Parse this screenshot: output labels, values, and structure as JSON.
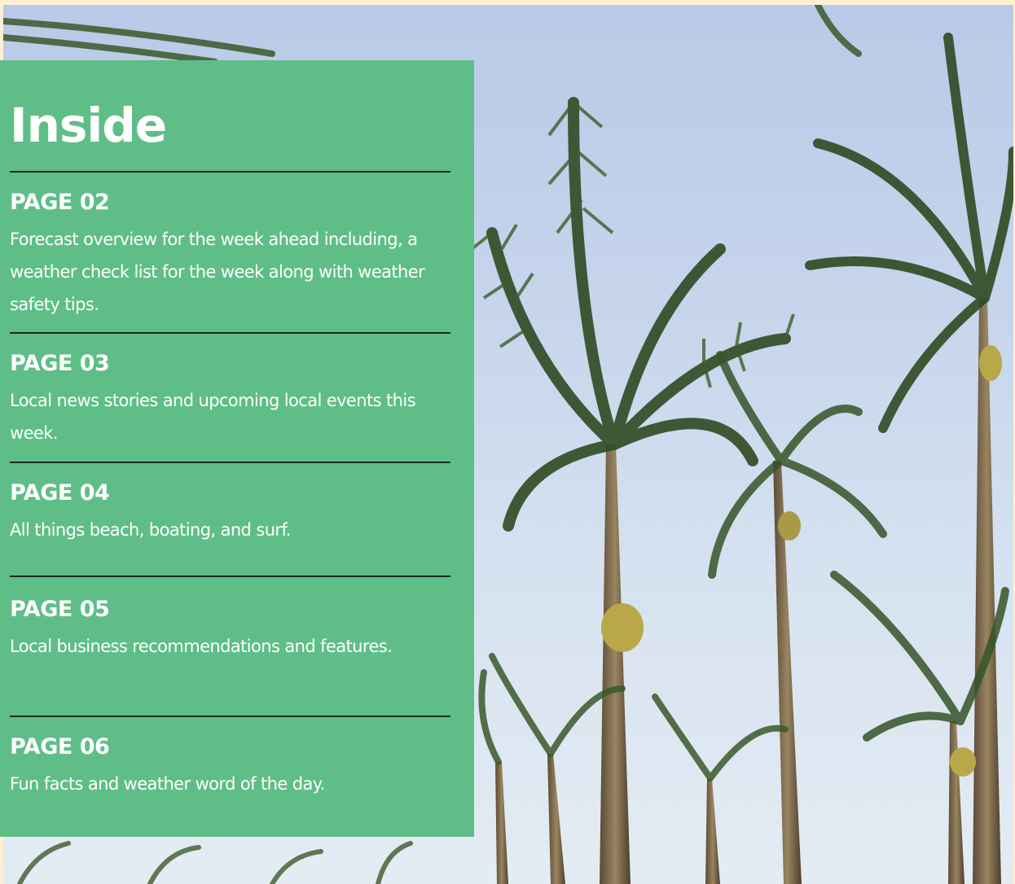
{
  "heading": "Inside",
  "sections": [
    {
      "page": "PAGE 02",
      "description": "Forecast overview for the week ahead including, a weather check list for the week along with weather safety tips."
    },
    {
      "page": "PAGE 03",
      "description": "Local news stories and upcoming local events this week."
    },
    {
      "page": "PAGE 04",
      "description": "All things beach, boating, and surf."
    },
    {
      "page": "PAGE 05",
      "description": "Local business recommendations and features."
    },
    {
      "page": "PAGE 06",
      "description": "Fun facts and weather word of the day."
    }
  ],
  "colors": {
    "panel": "#5fbe87",
    "page_border": "#fdf0d2",
    "rule": "#1b2a21",
    "text": "#ffffff"
  },
  "background_image": "palm-trees-photo"
}
